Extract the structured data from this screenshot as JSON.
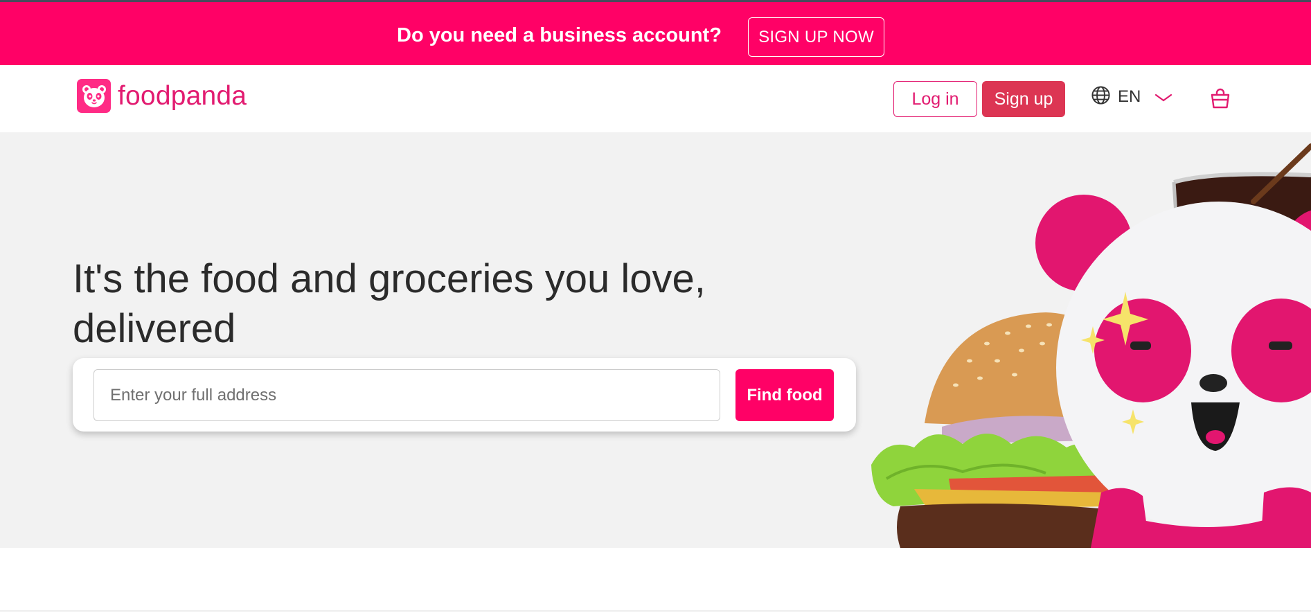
{
  "promo": {
    "text": "Do you need a business account?",
    "button_label": "SIGN UP NOW"
  },
  "header": {
    "brand": "foodpanda",
    "login_label": "Log in",
    "signup_label": "Sign up",
    "language": "EN",
    "icons": [
      "panda-logo-icon",
      "globe-icon",
      "chevron-down-icon",
      "shopping-bag-icon"
    ]
  },
  "hero": {
    "headline": "It's the food and groceries you love, delivered",
    "address_placeholder": "Enter your full address",
    "address_value": "",
    "find_label": "Find food",
    "image": "burger-cola-panda-mascot-illustration"
  },
  "colors": {
    "brand_pink": "#ff0166",
    "brand_text": "#e21b70",
    "signup_red": "#dc3553",
    "hero_bg": "#f2f2f2"
  }
}
